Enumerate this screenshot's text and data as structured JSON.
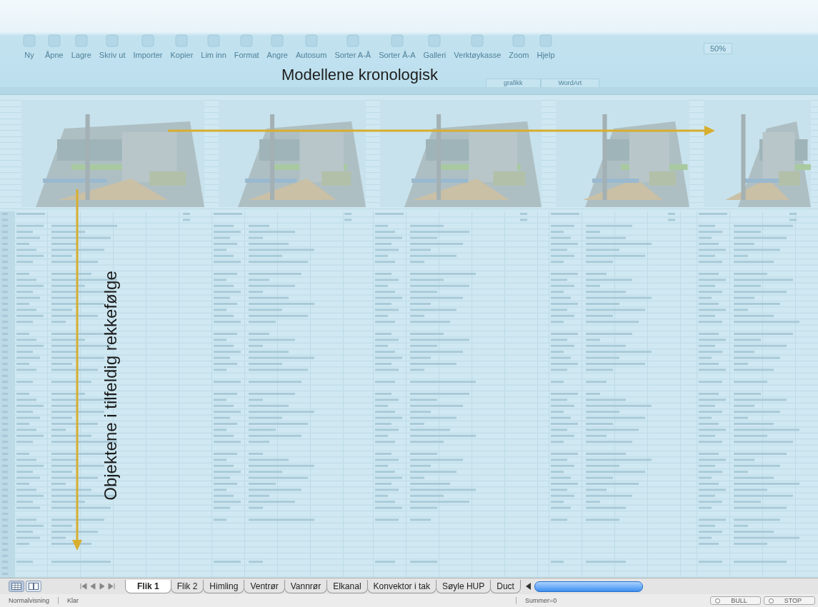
{
  "annotations": {
    "title": "Modellene kronologisk",
    "side": "Objektene i tilfeldig rekkefølge"
  },
  "toolbar": {
    "buttons": [
      "Ny",
      "Åpne",
      "Lagre",
      "Skriv ut",
      "Importer",
      "Kopier",
      "Lim inn",
      "Format",
      "Angre",
      "Autosum",
      "Sorter A-Å",
      "Sorter Å-A",
      "Galleri",
      "Verktøykasse",
      "Zoom",
      "Hjelp"
    ],
    "zoom": "50%",
    "ribbon_tabs": [
      "grafikk",
      "WordArt"
    ]
  },
  "sheet_tabs": [
    {
      "label": "Flik 1",
      "selected": true
    },
    {
      "label": "Flik 2",
      "selected": false
    },
    {
      "label": "Himling",
      "selected": false
    },
    {
      "label": "Ventrør",
      "selected": false
    },
    {
      "label": "Vannrør",
      "selected": false
    },
    {
      "label": "Elkanal",
      "selected": false
    },
    {
      "label": "Konvektor i tak",
      "selected": false
    },
    {
      "label": "Søyle HUP",
      "selected": false
    },
    {
      "label": "Duct",
      "selected": false
    }
  ],
  "status_bar": {
    "view": "Normalvisning",
    "state": "Klar",
    "sum": "Summer=0",
    "buttons": [
      "BULL",
      "STOP"
    ]
  }
}
